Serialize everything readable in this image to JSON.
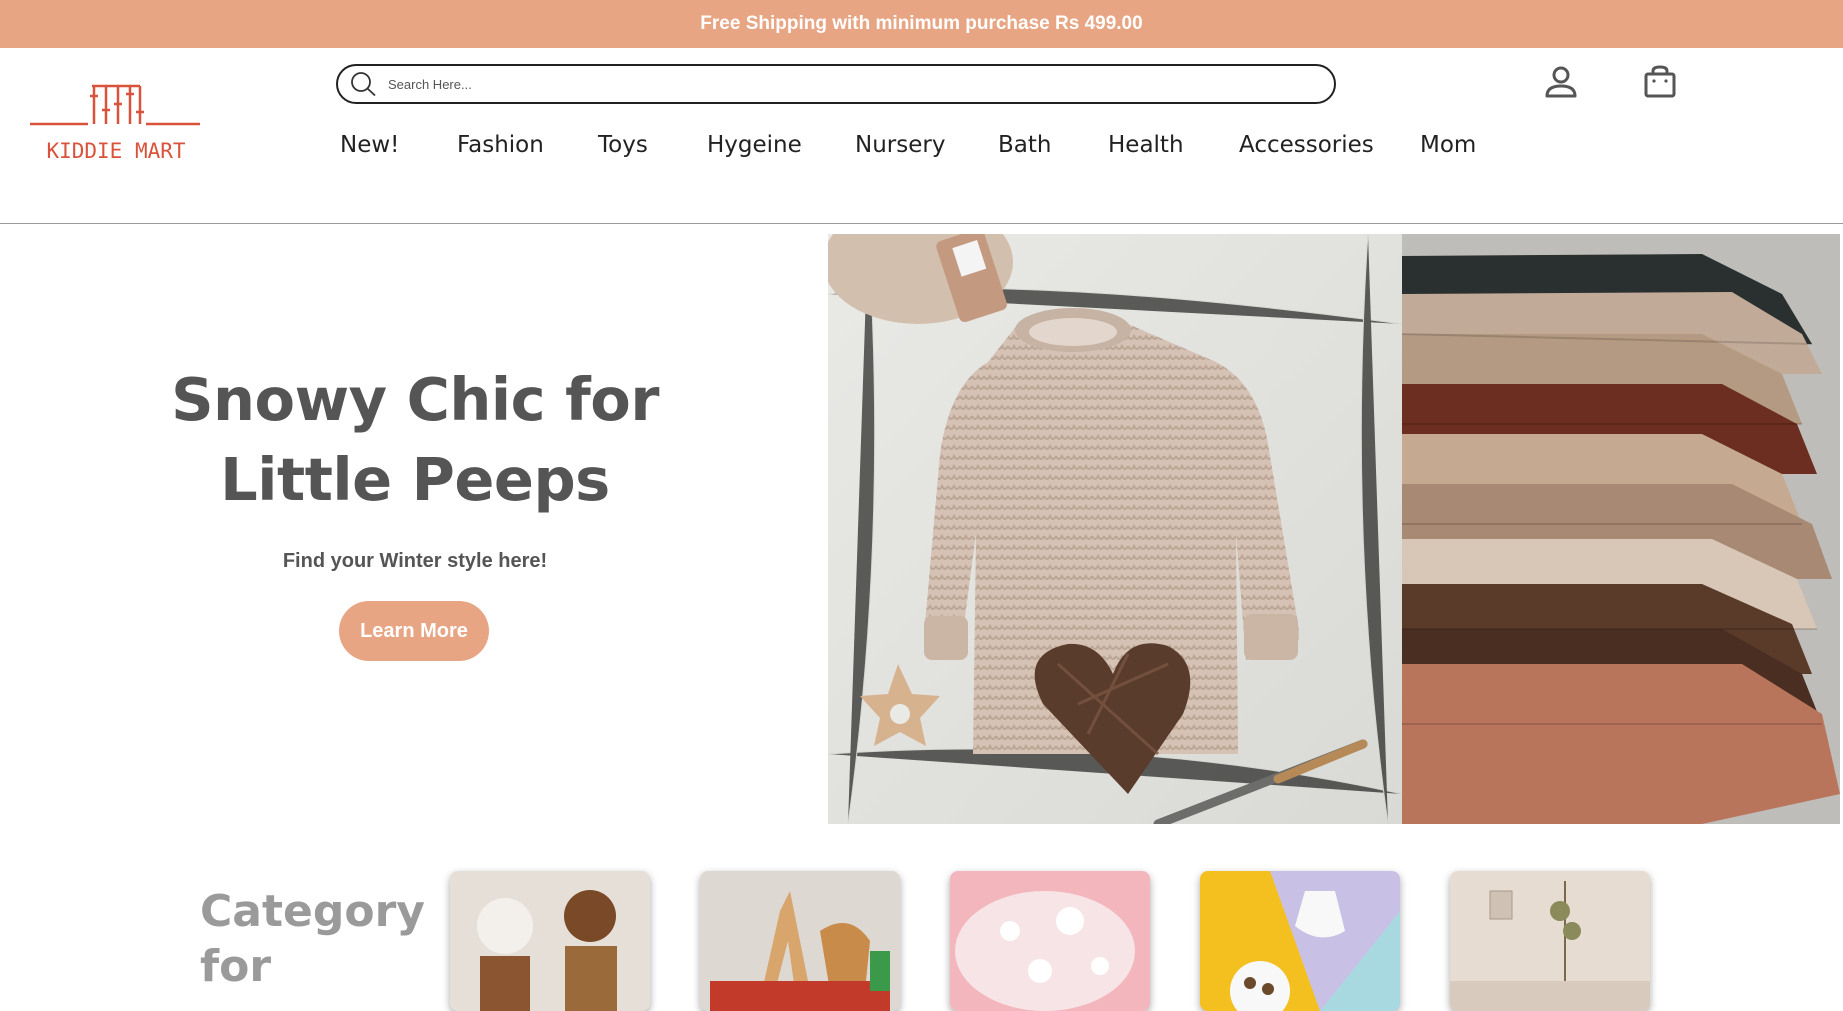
{
  "promo": {
    "text": "Free Shipping with minimum purchase Rs 499.00"
  },
  "logo": {
    "text": "KIDDIE MART"
  },
  "search": {
    "placeholder": "Search Here...",
    "icon": "search-icon"
  },
  "header_icons": {
    "account": "user-icon",
    "cart": "shopping-bag-icon"
  },
  "nav": [
    "New!",
    "Fashion",
    "Toys",
    "Hygeine",
    "Nursery",
    "Bath",
    "Health",
    "Accessories",
    "Mom"
  ],
  "hero": {
    "title_line1": "Snowy Chic for",
    "title_line2": "Little Peeps",
    "subtitle": "Find your Winter style here!",
    "button": "Learn More"
  },
  "category": {
    "title_line1": "Category",
    "title_line2": "for"
  },
  "colors": {
    "accent": "#e8a584",
    "logo_red": "#d9533c",
    "heading_gray": "#555555",
    "category_gray": "#9a9a9a"
  }
}
